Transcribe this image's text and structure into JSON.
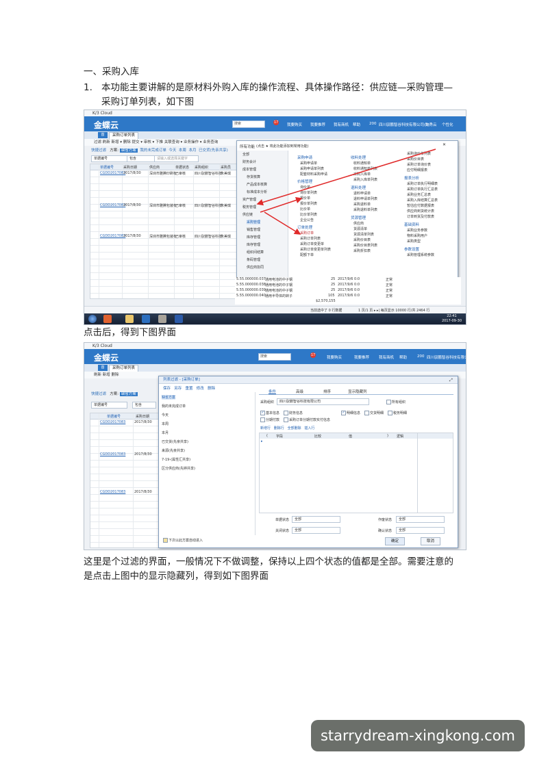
{
  "section_title": "一、采购入库",
  "step1": {
    "number": "1.",
    "line1": "本功能主要讲解的是原材料外购入库的操作流程、具体操作路径：供应链—采购管理—",
    "line2": "采购订单列表，如下图"
  },
  "caption_click": "点击后，得到下图界面",
  "caption_filter_line1": "这里是个过滤的界面，一般情况下不做调整，保持以上四个状态的值都是全部。需要注意的",
  "caption_filter_line2": "是点击上图中的显示隐藏列，得到如下图界面",
  "watermark": "starrydream-xingkong.com",
  "shot1": {
    "window_title": "K/3 Cloud",
    "logo": "金蝶云",
    "search_placeholder": "搜索",
    "badge": "17",
    "topnav": [
      "我要购买",
      "我要推荐",
      "我有商机",
      "帮助",
      "200",
      "四川驭鹏智谷科技有限公司(1)",
      "陈秀云",
      "个性化"
    ],
    "tab_home": "首",
    "tab_active": "采购订单列表",
    "toolbar": "过滤  刷新  新增 ▾  删除  提交 ▾  审核 ▾  下推  关联查询 ▾  业务操作 ▾  业务查询",
    "filter": [
      "快捷过滤",
      "方案:",
      "缺省方案",
      "我的未完成订单",
      "今天",
      "本周",
      "本月",
      "已交货(先亲共享)"
    ],
    "filter_field": "单据编号",
    "filter_op": "包含",
    "filter_hint": "请输入或选择关键字",
    "grid_headers": [
      "单据编号",
      "采购日期",
      "供应商",
      "单据状态",
      "采购组织",
      "采购员"
    ],
    "rows": [
      {
        "no": "CGDD2017083",
        "date": "2017/8/30",
        "supplier": "深圳市雅腾印刷有",
        "status": "已审核",
        "org": "四川驭鹏智谷科技",
        "buyer": "朱美琪"
      },
      {
        "no": "CGDD2017083",
        "date": "2017/8/30",
        "supplier": "深圳市雅腾包装有",
        "status": "已审核",
        "org": "四川驭鹏智谷科技",
        "buyer": "朱美琪"
      },
      {
        "no": "CGDD2017083",
        "date": "2017/8/30",
        "supplier": "深圳市雅腾包装有",
        "status": "已审核",
        "org": "四川驭鹏智谷科技",
        "buyer": "朱美琪"
      }
    ],
    "menu": {
      "header": "所有功能",
      "hint": "(点击 ★ 将此功能添加到常用功能)",
      "tree": [
        "全部",
        "财务会计",
        "成本管理",
        "存货核算",
        "产品成本核算",
        "标准成本分析",
        "资产管理",
        "税务管理",
        "供应链",
        "采购管理",
        "销售管理",
        "库存管理",
        "库存管理",
        "组织间结算",
        "条码管理",
        "供应商协同"
      ],
      "col1_head1": "采购申请",
      "col1_items1": [
        "采购申请单",
        "采购申请单列表",
        "配套材料采购申请"
      ],
      "col1_head2": "价格管理",
      "col1_items2": [
        "询价单",
        "询价单列表",
        "报价单",
        "报价单列表",
        "比价单",
        "比价单列表",
        "企业公告"
      ],
      "col1_head3": "订单处理",
      "col1_items3": [
        "采购订单",
        "采购订单列表",
        "采购订单变更单",
        "采购订单变更单列表",
        "配额下单"
      ],
      "col2_head1": "收料处理",
      "col2_items1": [
        "收料通知单",
        "收料通知单列表",
        "采购入库单",
        "采购入库单列表"
      ],
      "col2_head2": "退料处理",
      "col2_items2": [
        "退料申请单",
        "退料申请单列表",
        "采购退料单",
        "采购退料单列表"
      ],
      "col2_head3": "货源管理",
      "col2_items3": [
        "供应商",
        "货源清单",
        "货源清单列表",
        "采购价目表",
        "采购价目表列表",
        "采购折扣表"
      ],
      "col3_items1": [
        "采购询价单列表",
        "采购价目表",
        "采购订单询价表",
        "应付明细报表"
      ],
      "col3_head2": "报表分析",
      "col3_items2": [
        "采购订单执行明细表",
        "采购订单执行汇总表",
        "采购业务汇总表",
        "采购入库结算汇总表",
        "暂估应付数据报表",
        "供应商到货统计表",
        "订单到货及付款表"
      ],
      "col3_head3": "基础资料",
      "col3_items3": [
        "采购业务参数",
        "物料采购用户",
        "采购类型"
      ],
      "col3_head4": "参数设置",
      "col3_items4": [
        "采购管理系统参数"
      ]
    },
    "bottom_rows": [
      {
        "code": "5.55.000000.037",
        "name": "通用电池的中子钢",
        "qty": "25",
        "date": "2017/9/6 0:0",
        "status": "正常"
      },
      {
        "code": "5.55.000000.038",
        "name": "通用电池的中子钢",
        "qty": "25",
        "date": "2017/9/6 0:0",
        "status": "正常"
      },
      {
        "code": "5.55.000000.039",
        "name": "通用电池的中子钢",
        "qty": "25",
        "date": "2017/9/6 0:0",
        "status": "正常"
      },
      {
        "code": "5.55.000000.040",
        "name": "通用半导体的转子",
        "qty": "105",
        "date": "2017/9/6 0:0",
        "status": "正常"
      }
    ],
    "total": "$2,570,155",
    "statusbar": "当前选中了 0 行数据",
    "pager": "1 页/1 页  ▸  ▸|  每页显示  10000  行/共 2464 行",
    "clock_time": "22:41",
    "clock_date": "2017-09-30"
  },
  "shot2": {
    "window_title": "K/3 Cloud",
    "logo": "金蝶云",
    "search_placeholder": "搜索",
    "badge": "17",
    "topnav": [
      "我要购买",
      "我要推荐",
      "我有商机",
      "帮助",
      "200",
      "四川驭鹏智谷科技有限公司"
    ],
    "tab_home": "首",
    "tab_active": "采购订单列表",
    "toolbar": "刷新  新增  删除",
    "filter": [
      "快捷过滤",
      "方案:",
      "缺省方案"
    ],
    "filter_field": "单据编号",
    "filter_op": "包含",
    "grid_headers": [
      "单据编号",
      "采购日期"
    ],
    "rows": [
      {
        "no": "CGDD2017083",
        "date": "2017/8/30"
      },
      {
        "no": "CGDD2017083",
        "date": "2017/8/30"
      },
      {
        "no": "CGDD2017083",
        "date": "2017/8/30"
      }
    ],
    "dialog": {
      "title": "列表过滤 - [采购订单]",
      "menu": [
        "保存",
        "另存",
        "重置",
        "修改",
        "删除"
      ],
      "schemes": [
        "缺省方案",
        "我的未完成订单",
        "今天",
        "本周",
        "本月",
        "已交货(先亲共享)",
        "来源(先亲共享)",
        "7-19-(属性汇共享)",
        "区分供应商(先婷共享)"
      ],
      "tabs": [
        "条件",
        "高级",
        "排序",
        "显示隐藏列"
      ],
      "org_label": "采购组织",
      "org_value": "四川驭鹏智谷科技有限公司",
      "all_org": "所有组织",
      "checks1": [
        "基本信息",
        "财务信息",
        "明细信息",
        "交货明细",
        "税务明细"
      ],
      "checks2": [
        "分期付款",
        "采购订单分期付款实付信息"
      ],
      "actions": [
        "新增行",
        "删除行",
        "全部删除",
        "插入行"
      ],
      "cond_headers": [
        "(",
        "字段",
        "比较",
        "值",
        ")",
        "逻辑"
      ],
      "status_rows": [
        {
          "label": "单据状态",
          "value": "全部"
        },
        {
          "label": "作废状态",
          "value": "全部"
        },
        {
          "label": "关闭状态",
          "value": "全部"
        },
        {
          "label": "确认状态",
          "value": "全部"
        }
      ],
      "remember": "下次以此方案自动进入",
      "ok": "确定",
      "cancel": "取消"
    }
  }
}
